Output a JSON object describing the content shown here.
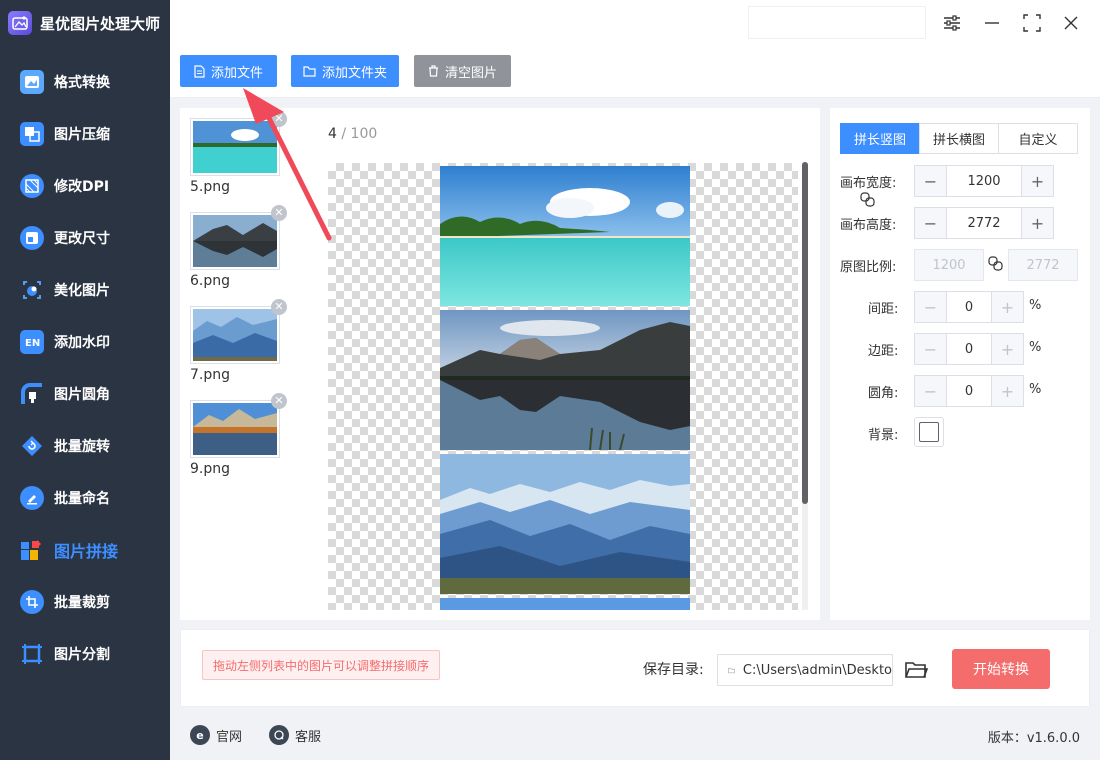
{
  "app": {
    "title": "星优图片处理大师"
  },
  "sidebar": {
    "items": [
      {
        "label": "格式转换",
        "icon": "image-convert-icon"
      },
      {
        "label": "图片压缩",
        "icon": "compress-icon"
      },
      {
        "label": "修改DPI",
        "icon": "dpi-icon"
      },
      {
        "label": "更改尺寸",
        "icon": "resize-icon"
      },
      {
        "label": "美化图片",
        "icon": "beautify-icon"
      },
      {
        "label": "添加水印",
        "icon": "watermark-icon"
      },
      {
        "label": "图片圆角",
        "icon": "round-corner-icon"
      },
      {
        "label": "批量旋转",
        "icon": "rotate-icon"
      },
      {
        "label": "批量命名",
        "icon": "rename-icon"
      },
      {
        "label": "图片拼接",
        "icon": "stitch-icon",
        "active": true
      },
      {
        "label": "批量裁剪",
        "icon": "crop-icon"
      },
      {
        "label": "图片分割",
        "icon": "split-icon"
      }
    ]
  },
  "toolbar": {
    "add_file": "添加文件",
    "add_folder": "添加文件夹",
    "clear": "清空图片"
  },
  "files": [
    {
      "name": "5.png"
    },
    {
      "name": "6.png"
    },
    {
      "name": "7.png"
    },
    {
      "name": "9.png"
    }
  ],
  "counter": {
    "current": "4",
    "sep": " / ",
    "total": "100"
  },
  "settings": {
    "tabs": [
      "拼长竖图",
      "拼长横图",
      "自定义"
    ],
    "active_tab": 0,
    "canvas_width_label": "画布宽度:",
    "canvas_width": "1200",
    "canvas_height_label": "画布高度:",
    "canvas_height": "2772",
    "ratio_label": "原图比例:",
    "ratio_w": "1200",
    "ratio_h": "2772",
    "spacing_label": "间距:",
    "spacing": "0",
    "margin_label": "边距:",
    "margin": "0",
    "radius_label": "圆角:",
    "radius": "0",
    "percent": "%",
    "bg_label": "背景:",
    "bg_color": "#ffffff"
  },
  "bottom": {
    "hint": "拖动左侧列表中的图片可以调整拼接顺序",
    "save_label": "保存目录:",
    "save_path": "C:\\Users\\admin\\Deskto",
    "start": "开始转换"
  },
  "footer": {
    "website": "官网",
    "support": "客服",
    "version": "版本：v1.6.0.0"
  },
  "colors": {
    "accent": "#3d8eff",
    "danger": "#f56c6c",
    "sidebar_bg": "#2b3442"
  }
}
